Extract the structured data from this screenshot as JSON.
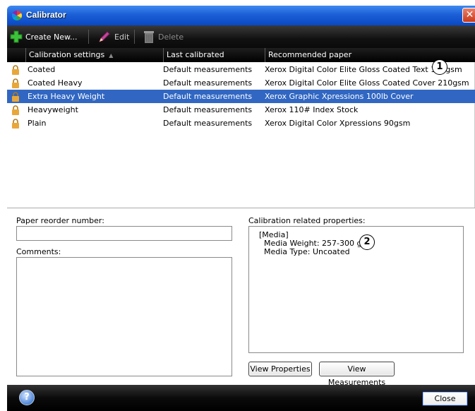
{
  "window": {
    "title": "Calibrator",
    "close_glyph": "✕"
  },
  "toolbar": {
    "create_label": "Create New...",
    "edit_label": "Edit",
    "delete_label": "Delete"
  },
  "list": {
    "columns": [
      "Calibration settings",
      "Last calibrated",
      "Recommended paper"
    ],
    "rows": [
      {
        "name": "Coated",
        "last": "Default measurements",
        "paper": "Xerox Digital Color Elite Gloss Coated Text 140gsm"
      },
      {
        "name": "Coated Heavy",
        "last": "Default measurements",
        "paper": "Xerox Digital Color Elite Gloss Coated Cover 210gsm"
      },
      {
        "name": "Extra Heavy Weight",
        "last": "Default measurements",
        "paper": "Xerox Graphic Xpressions 100lb Cover"
      },
      {
        "name": "Heavyweight",
        "last": "Default measurements",
        "paper": "Xerox 110# Index Stock"
      },
      {
        "name": "Plain",
        "last": "Default measurements",
        "paper": "Xerox Digital Color Xpressions 90gsm"
      }
    ],
    "selected_row": 2
  },
  "callouts": {
    "one": "1",
    "two": "2"
  },
  "details": {
    "reorder_label": "Paper reorder number:",
    "reorder_value": "",
    "comments_label": "Comments:",
    "comments_value": "",
    "props_label": "Calibration related properties:",
    "props_lines": [
      "[Media]",
      "Media Weight: 257-300 gsm",
      "Media Type: Uncoated"
    ],
    "view_properties_label": "View Properties",
    "view_measurements_label": "View Measurements"
  },
  "footer": {
    "help_glyph": "?",
    "close_label": "Close"
  },
  "colors": {
    "titlebar": "#1c5fd6",
    "selection": "#3167c2",
    "toolbar": "#111111"
  }
}
